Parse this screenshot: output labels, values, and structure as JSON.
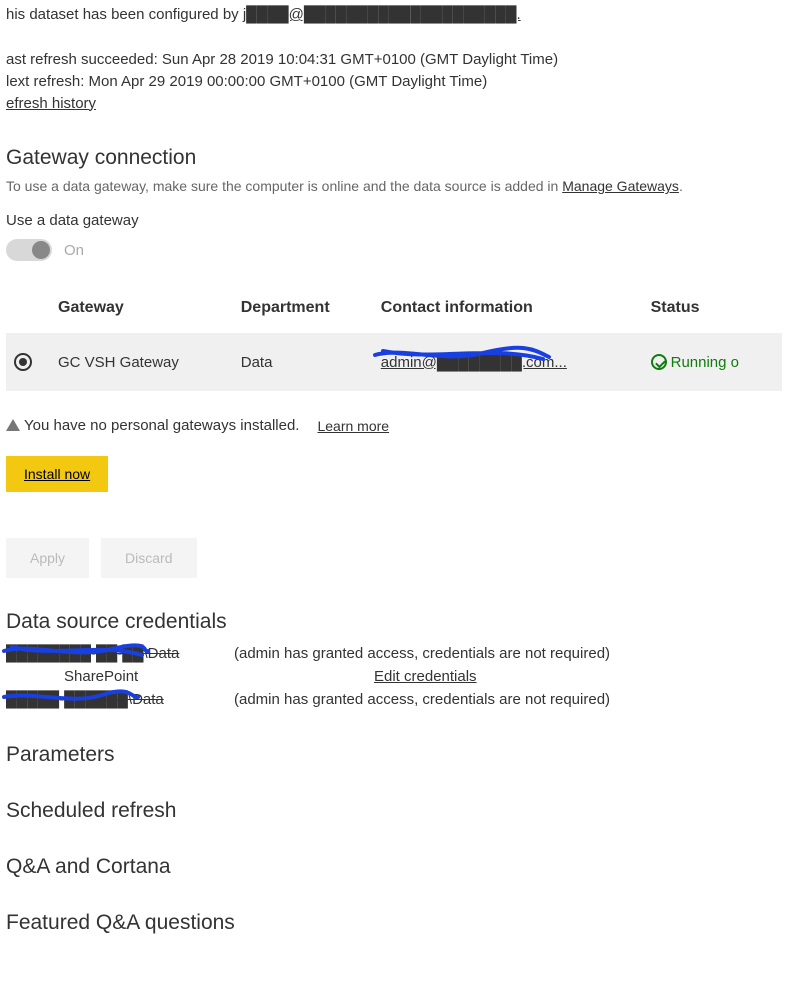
{
  "intro": {
    "prefix": "his dataset has been configured by ",
    "configured_by_redacted": "j████@████████████████████."
  },
  "refresh": {
    "last": "ast refresh succeeded: Sun Apr 28 2019 10:04:31 GMT+0100 (GMT Daylight Time)",
    "next": "lext refresh: Mon Apr 29 2019 00:00:00 GMT+0100 (GMT Daylight Time)",
    "history_link": "efresh history"
  },
  "gateway": {
    "heading": "Gateway connection",
    "hint_prefix": "To use a data gateway, make sure the computer is online and the data source is added in ",
    "manage_link": "Manage Gateways",
    "hint_suffix": ".",
    "use_label": "Use a data gateway",
    "toggle_state": "On",
    "columns": {
      "gateway": "Gateway",
      "department": "Department",
      "contact": "Contact information",
      "status": "Status"
    },
    "rows": [
      {
        "selected": true,
        "gateway": "GC VSH Gateway",
        "department": "Data",
        "contact_redacted": "admin@████████.com...",
        "status": "Running o"
      }
    ],
    "personal_warning": "You have no personal gateways installed.",
    "learn_more": "Learn more",
    "install_button": "Install now"
  },
  "actions": {
    "apply": "Apply",
    "discard": "Discard"
  },
  "credentials": {
    "heading": "Data source credentials",
    "rows": [
      {
        "name_redacted": "████████-██-██\\Data",
        "note": "(admin has granted access, credentials are not required)"
      },
      {
        "name": "SharePoint",
        "edit_label": "Edit credentials"
      },
      {
        "name_redacted": "█████-██████\\Data",
        "note": "(admin has granted access, credentials are not required)"
      }
    ]
  },
  "sections": {
    "parameters": "Parameters",
    "scheduled": "Scheduled refresh",
    "qna": "Q&A and Cortana",
    "featured": "Featured Q&A questions"
  }
}
